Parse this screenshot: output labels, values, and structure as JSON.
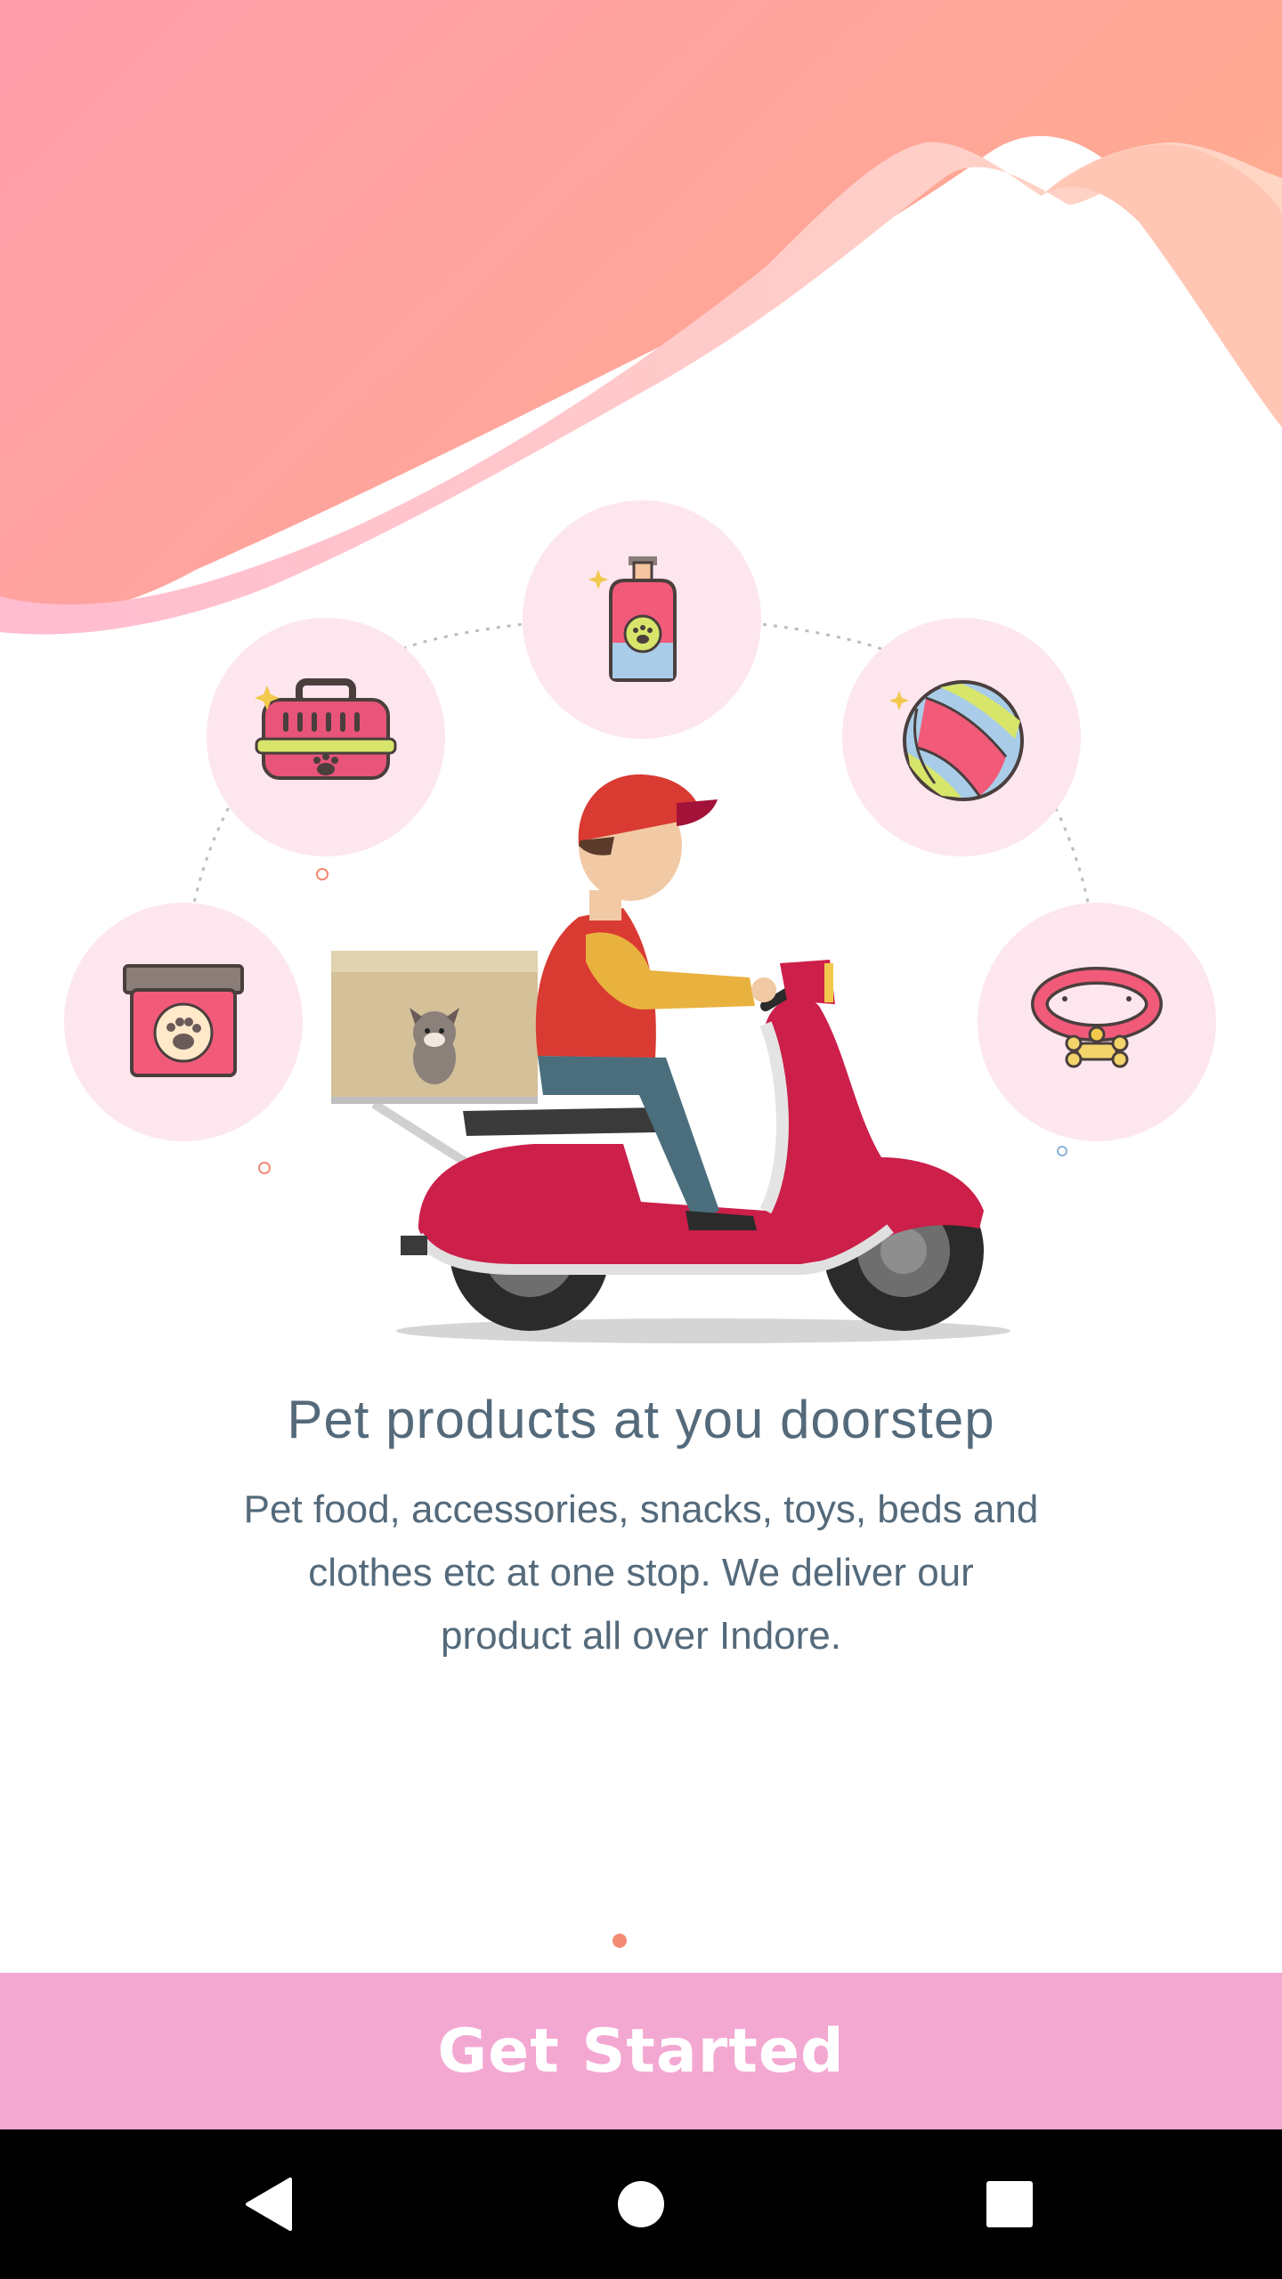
{
  "onboarding": {
    "headline": "Pet products at you doorstep",
    "description": "Pet food, accessories, snacks, toys, beds and clothes etc at one stop. We deliver our product all over Indore.",
    "page_index": 1,
    "page_count": 1
  },
  "cta": {
    "label": "Get Started"
  },
  "icons": [
    "pet-food-jar-icon",
    "pet-carrier-icon",
    "pet-shampoo-icon",
    "ball-icon",
    "dog-collar-icon",
    "delivery-scooter-illustration"
  ],
  "nav": {
    "back": "back-icon",
    "home": "home-icon",
    "recents": "recents-icon"
  },
  "colors": {
    "primary": "#f3a8d2",
    "accent": "#f38a73",
    "text": "#546a7b",
    "scooter": "#cc1f4a"
  }
}
